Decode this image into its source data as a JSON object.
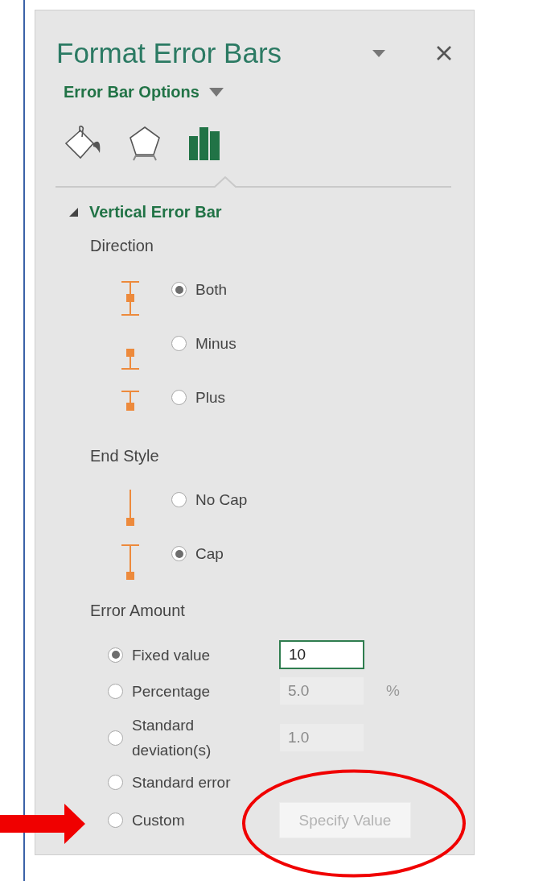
{
  "pane": {
    "title": "Format Error Bars",
    "options_menu": "Error Bar Options"
  },
  "tabs": [
    {
      "kind": "fill",
      "selected": false
    },
    {
      "kind": "shape",
      "selected": false
    },
    {
      "kind": "options",
      "selected": true
    }
  ],
  "section": {
    "title": "Vertical Error Bar",
    "expanded": true
  },
  "direction": {
    "label": "Direction",
    "options": [
      {
        "kind": "both",
        "label": "Both",
        "selected": true
      },
      {
        "kind": "minus",
        "label": "Minus",
        "selected": false
      },
      {
        "kind": "plus",
        "label": "Plus",
        "selected": false
      }
    ]
  },
  "end_style": {
    "label": "End Style",
    "options": [
      {
        "kind": "no_cap",
        "label": "No Cap",
        "selected": false
      },
      {
        "kind": "cap",
        "label": "Cap",
        "selected": true
      }
    ]
  },
  "error_amount": {
    "label": "Error Amount",
    "options": [
      {
        "label": "Fixed value",
        "selected": true,
        "field": {
          "value": "10",
          "disabled": false
        }
      },
      {
        "label": "Percentage",
        "selected": false,
        "field": {
          "value": "5.0",
          "disabled": true
        },
        "unit": "%"
      },
      {
        "label": "Standard deviation(s)",
        "selected": false,
        "field": {
          "value": "1.0",
          "disabled": true
        }
      },
      {
        "label": "Standard error",
        "selected": false
      },
      {
        "label": "Custom",
        "selected": false,
        "button": {
          "label": "Specify Value",
          "disabled": true
        }
      }
    ]
  }
}
